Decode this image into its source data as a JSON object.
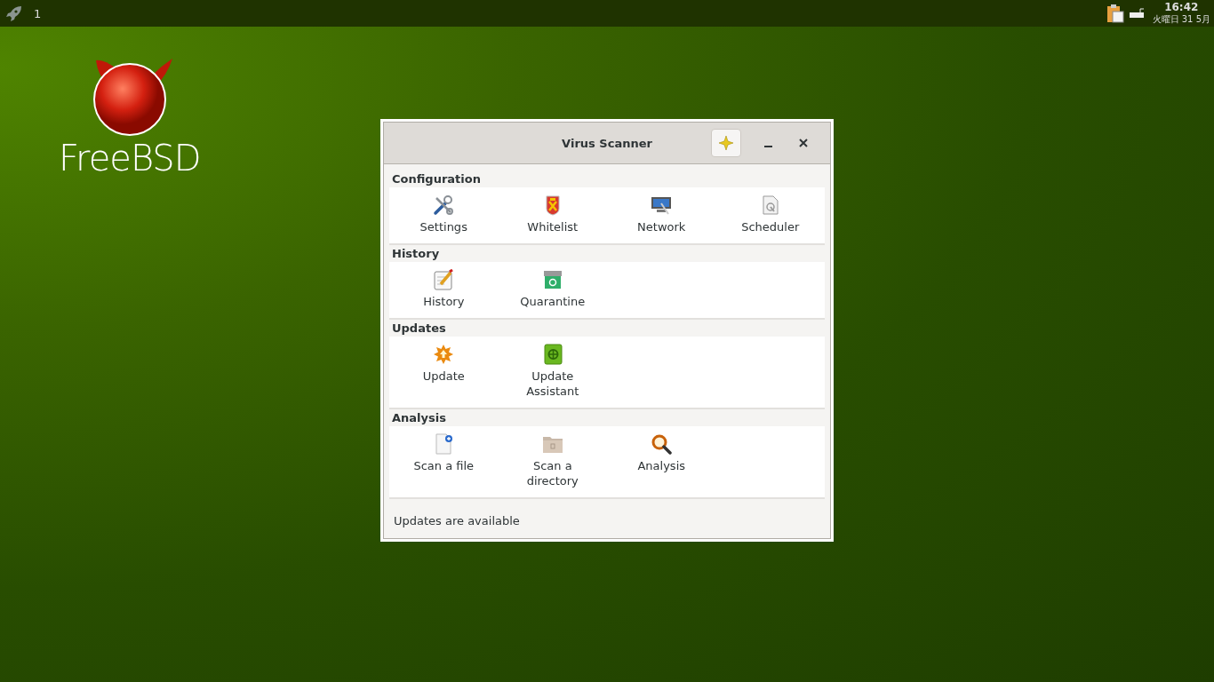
{
  "top_panel": {
    "workspace": "1",
    "clock_time": "16:42",
    "clock_date": "火曜日 31 5月"
  },
  "desktop": {
    "logo_text": "FreeBSD"
  },
  "window": {
    "title": "Virus Scanner",
    "sections": [
      {
        "title": "Configuration",
        "items": [
          {
            "label": "Settings",
            "kind": "tools"
          },
          {
            "label": "Whitelist",
            "kind": "shield"
          },
          {
            "label": "Network",
            "kind": "network"
          },
          {
            "label": "Scheduler",
            "kind": "scheduler"
          }
        ]
      },
      {
        "title": "History",
        "items": [
          {
            "label": "History",
            "kind": "notes"
          },
          {
            "label": "Quarantine",
            "kind": "quarantine"
          }
        ]
      },
      {
        "title": "Updates",
        "items": [
          {
            "label": "Update",
            "kind": "update"
          },
          {
            "label": "Update Assistant",
            "kind": "assistant"
          }
        ]
      },
      {
        "title": "Analysis",
        "items": [
          {
            "label": "Scan a file",
            "kind": "file"
          },
          {
            "label": "Scan a directory",
            "kind": "folder"
          },
          {
            "label": "Analysis",
            "kind": "search"
          }
        ]
      }
    ],
    "status": "Updates are available"
  }
}
